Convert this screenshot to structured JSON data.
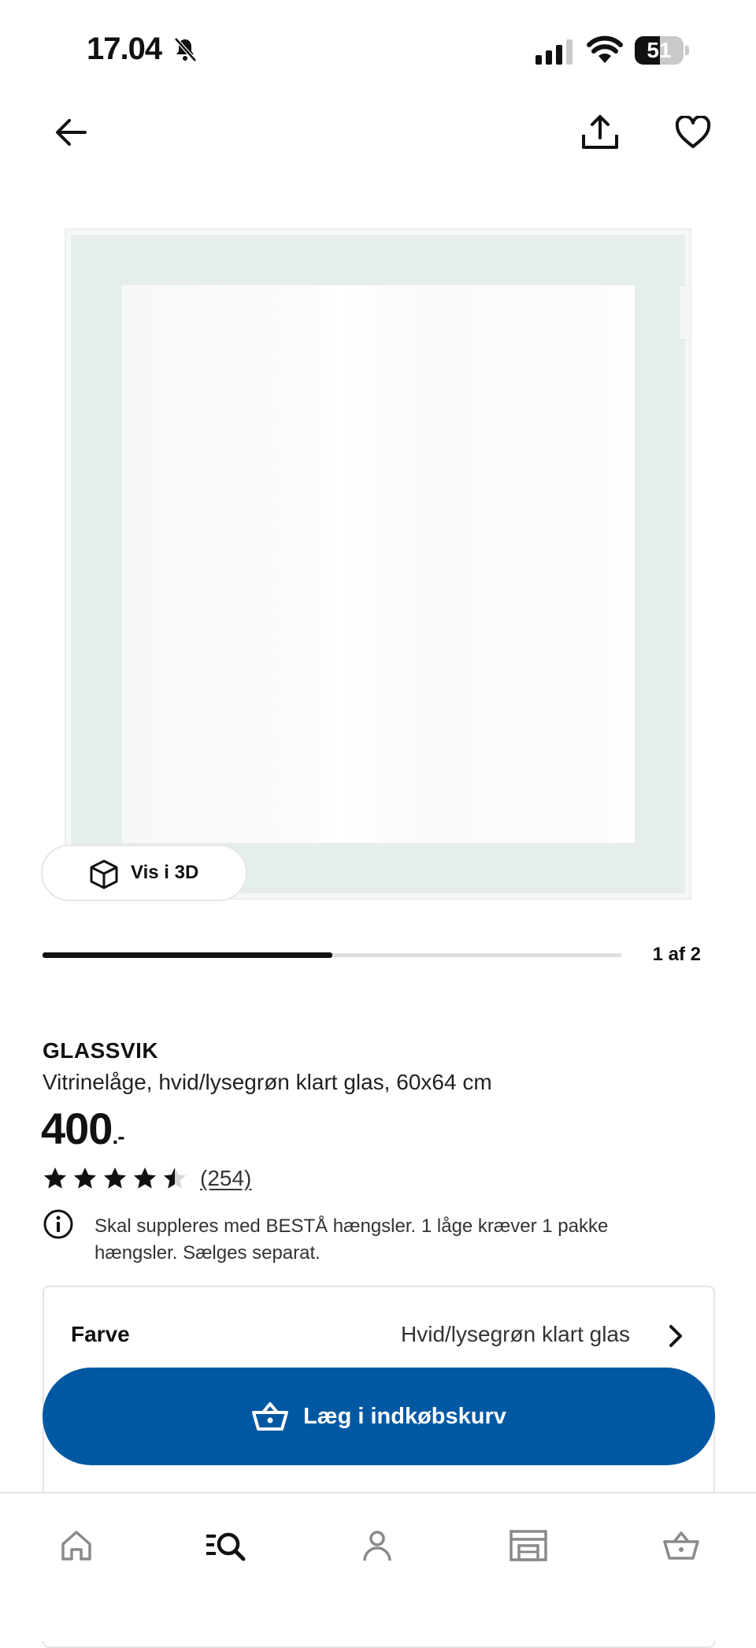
{
  "status_bar": {
    "time": "17.04",
    "battery": "51",
    "battery_level": 0.51
  },
  "product": {
    "brand": "GLASSVIK",
    "description": "Vitrinelåge, hvid/lysegrøn klart glas, 60x64 cm",
    "price": "400",
    "price_suffix": ".-",
    "rating": 4.5,
    "reviews": "(254)",
    "notice": "Skal suppleres med BESTÅ hængsler. 1 låge kræver 1 pakke hængsler. Sælges separat."
  },
  "gallery": {
    "view_3d_label": "Vis i 3D",
    "page_indicator": "1 af 2",
    "progress": 0.5
  },
  "options": {
    "color_label": "Farve",
    "color_value": "Hvid/lysegrøn klart glas"
  },
  "cta": {
    "add_to_cart_label": "Læg i indkøbskurv",
    "color": "#0058a3"
  },
  "nav": {
    "items": [
      {
        "name": "home",
        "icon": "home-icon"
      },
      {
        "name": "search",
        "icon": "search-icon"
      },
      {
        "name": "profile",
        "icon": "person-icon"
      },
      {
        "name": "store",
        "icon": "store-icon"
      },
      {
        "name": "cart",
        "icon": "basket-icon"
      }
    ]
  }
}
